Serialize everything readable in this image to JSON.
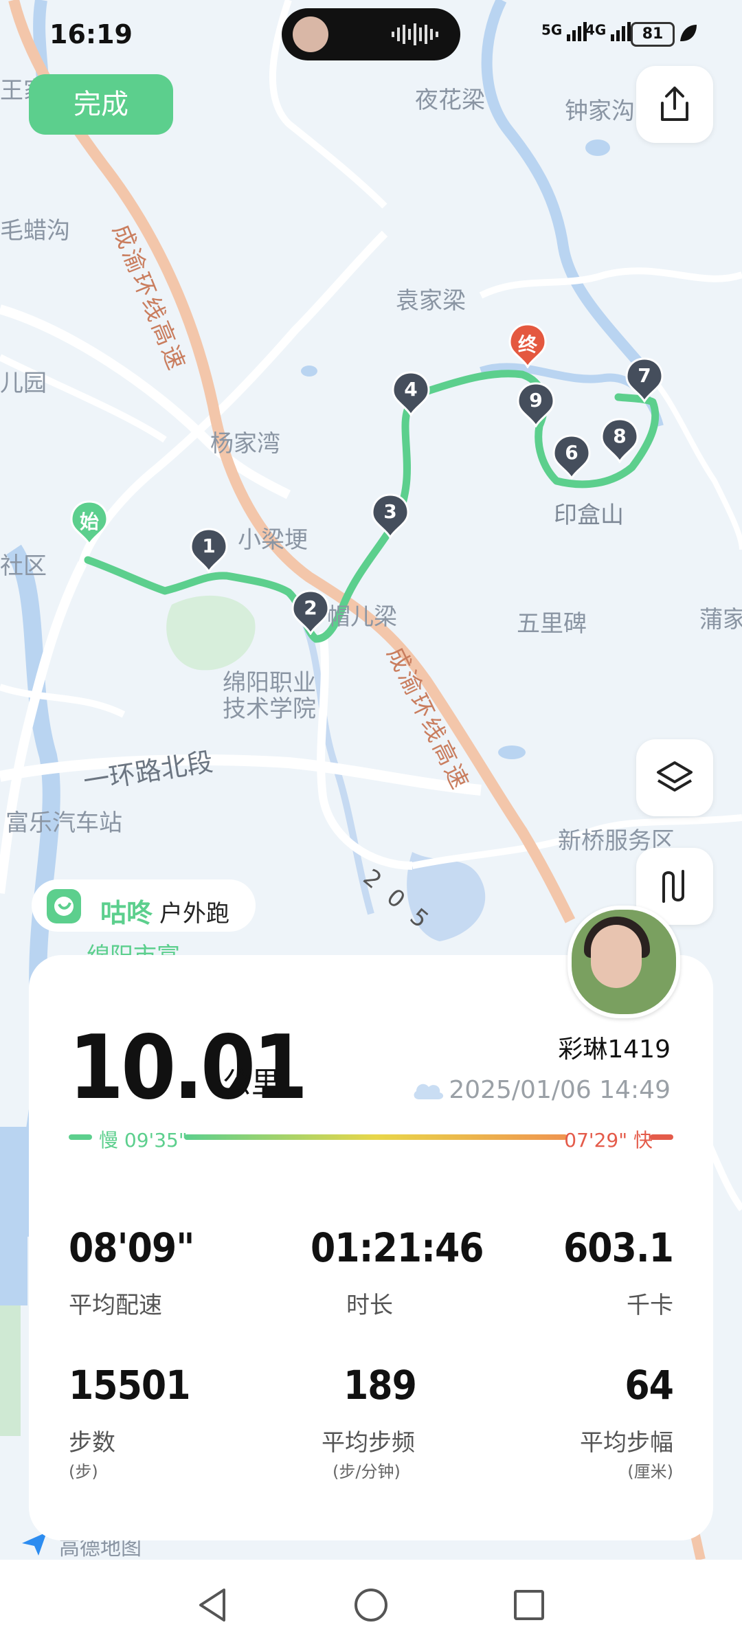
{
  "status_bar": {
    "time": "16:19",
    "network_1": "5G",
    "network_2": "4G",
    "battery": "81"
  },
  "top": {
    "done_label": "完成"
  },
  "map": {
    "places": [
      "夜花梁",
      "钟家沟",
      "毛蜡沟",
      "袁家梁",
      "杨家湾",
      "小梁埂",
      "帽儿梁",
      "五里碑",
      "蒲家",
      "印盒山",
      "绵阳职业",
      "技术学院",
      "一环路北段",
      "富乐汽车站",
      "新桥服务区",
      "绵阳市富",
      "社区",
      "儿园",
      "王家",
      "2 0 5"
    ],
    "highway_1": "成渝环线高速",
    "highway_2": "成渝环线高速",
    "start_marker": "始",
    "end_marker": "终",
    "km_markers": [
      "1",
      "2",
      "3",
      "4",
      "6",
      "7",
      "8",
      "9"
    ],
    "attribution": "高德地图"
  },
  "brand": {
    "name": "咕咚",
    "mode": "户外跑"
  },
  "summary": {
    "distance": "10.01",
    "distance_unit": "公里",
    "username": "彩琳1419",
    "datetime": "2025/01/06 14:49",
    "pace_slow": "慢 09'35\"",
    "pace_fast": "07'29\" 快"
  },
  "stats": [
    {
      "value": "08'09\"",
      "label": "平均配速",
      "sub": ""
    },
    {
      "value": "01:21:46",
      "label": "时长",
      "sub": ""
    },
    {
      "value": "603.1",
      "label": "千卡",
      "sub": ""
    },
    {
      "value": "15501",
      "label": "步数",
      "sub": "(步)"
    },
    {
      "value": "189",
      "label": "平均步频",
      "sub": "(步/分钟)"
    },
    {
      "value": "64",
      "label": "平均步幅",
      "sub": "(厘米)"
    }
  ],
  "colors": {
    "accent_green": "#5ccf8d",
    "pace_fast_red": "#e45b4a",
    "marker_dark": "#454e5c",
    "highway": "#f1c0a3"
  }
}
